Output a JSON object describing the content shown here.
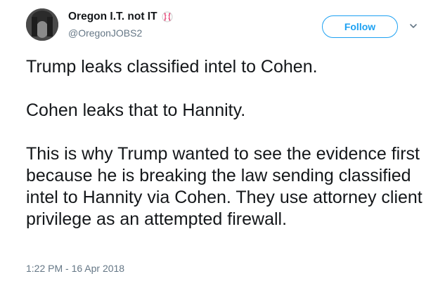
{
  "tweet": {
    "author_name": "Oregon I.T. not IT",
    "author_handle": "@OregonJOBS2",
    "name_emoji_icon": "baseball-icon",
    "follow_label": "Follow",
    "menu_icon": "chevron-down-icon",
    "paragraphs": [
      "Trump leaks classified intel to Cohen.",
      "Cohen leaks that to Hannity.",
      "This is why Trump wanted to see the evidence first because he is breaking the law sending classified intel to Hannity via Cohen. They use attorney client privilege as an attempted firewall."
    ],
    "timestamp": "1:22 PM - 16 Apr 2018"
  },
  "colors": {
    "accent": "#1da1f2",
    "text": "#14171a",
    "muted": "#657786",
    "baseball_stitch": "#e0245e"
  }
}
